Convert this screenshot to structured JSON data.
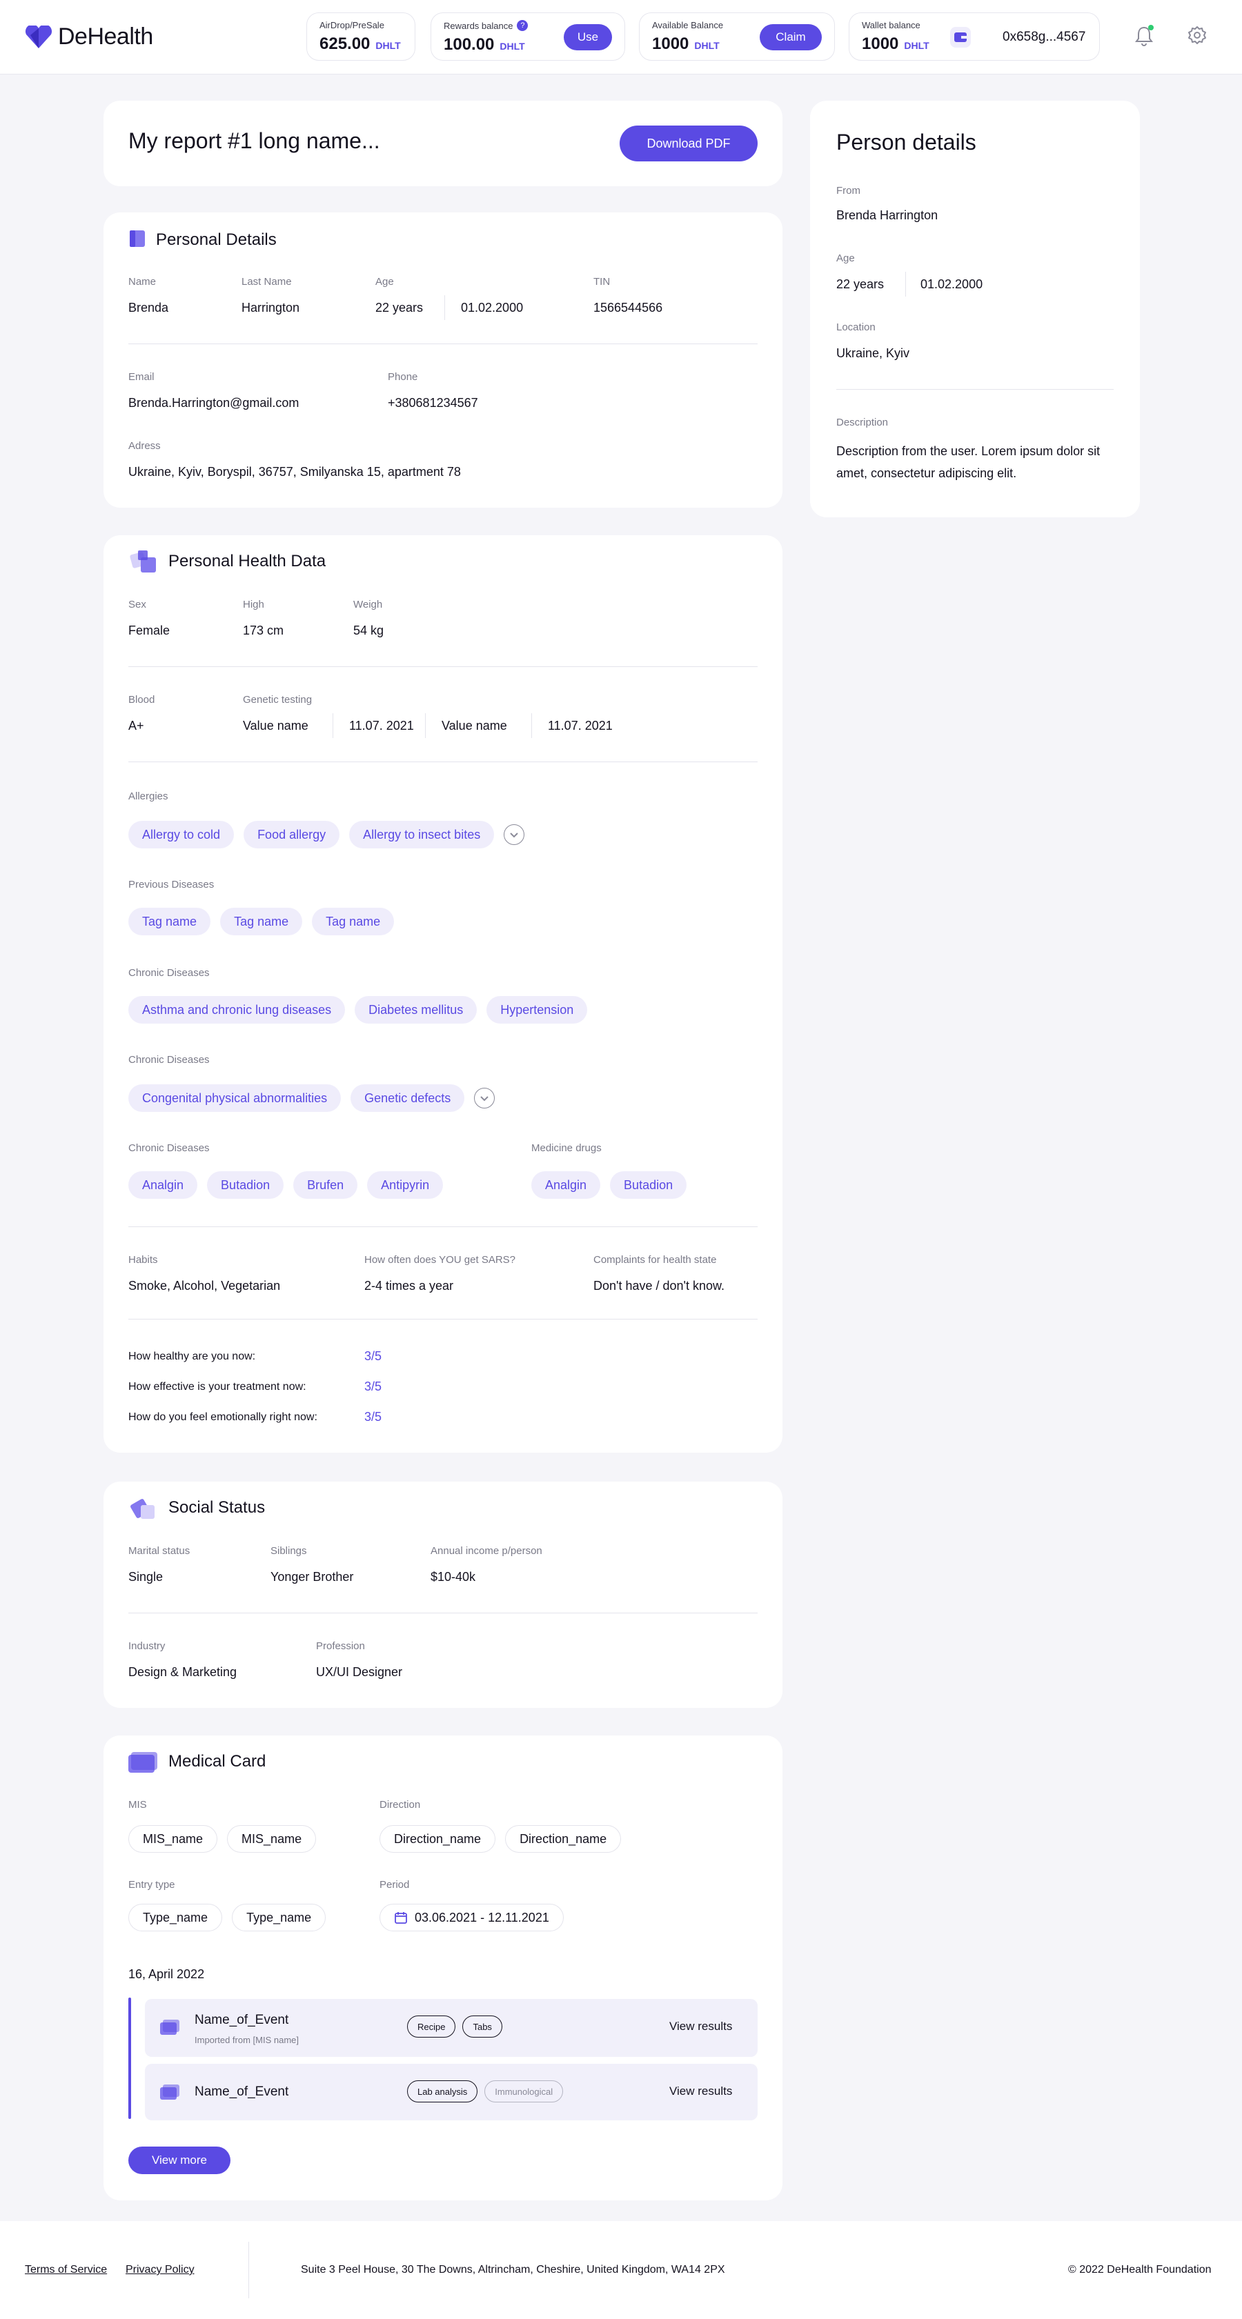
{
  "brand": {
    "name": "DeHealth"
  },
  "header": {
    "airdrop": {
      "label": "AirDrop/PreSale",
      "value": "625.00",
      "unit": "DHLT"
    },
    "rewards": {
      "label": "Rewards balance",
      "help": "?",
      "value": "100.00",
      "unit": "DHLT",
      "button": "Use"
    },
    "available": {
      "label": "Available Balance",
      "value": "1000",
      "unit": "DHLT",
      "button": "Claim"
    },
    "wallet": {
      "label": "Wallet balance",
      "value": "1000",
      "unit": "DHLT",
      "address": "0x658g...4567"
    }
  },
  "report": {
    "title": "My report #1 long name...",
    "download": "Download PDF"
  },
  "personal": {
    "title": "Personal Details",
    "name_label": "Name",
    "name": "Brenda",
    "last_label": "Last Name",
    "last": "Harrington",
    "age_label": "Age",
    "age": "22 years",
    "dob": "01.02.2000",
    "tin_label": "TIN",
    "tin": "1566544566",
    "email_label": "Email",
    "email": "Brenda.Harrington@gmail.com",
    "phone_label": "Phone",
    "phone": "+380681234567",
    "address_label": "Adress",
    "address": "Ukraine, Kyiv, Boryspil, 36757, Smilyanska 15, apartment 78"
  },
  "health": {
    "title": "Personal Health Data",
    "sex_label": "Sex",
    "sex": "Female",
    "high_label": "High",
    "high": "173 cm",
    "weigh_label": "Weigh",
    "weigh": "54 kg",
    "blood_label": "Blood",
    "blood": "A+",
    "genetic_label": "Genetic testing",
    "genetic": [
      {
        "name": "Value name",
        "date": "11.07. 2021"
      },
      {
        "name": "Value name",
        "date": "11.07. 2021"
      }
    ],
    "allergies_label": "Allergies",
    "allergies": [
      "Allergy to cold",
      "Food allergy",
      "Allergy to insect bites"
    ],
    "previous_label": "Previous Diseases",
    "previous": [
      "Tag name",
      "Tag name",
      "Tag name"
    ],
    "chronic1_label": "Chronic Diseases",
    "chronic1": [
      "Asthma and chronic lung diseases",
      "Diabetes mellitus",
      "Hypertension"
    ],
    "chronic2_label": "Chronic Diseases",
    "chronic2": [
      "Congenital physical abnormalities",
      "Genetic defects"
    ],
    "chronic3_label": "Chronic Diseases",
    "chronic3": [
      "Analgin",
      "Butadion",
      "Brufen",
      "Antipyrin"
    ],
    "medicine_label": "Medicine drugs",
    "medicine": [
      "Analgin",
      "Butadion"
    ],
    "habits_label": "Habits",
    "habits": "Smoke, Alcohol, Vegetarian",
    "sars_label": "How often does YOU get SARS?",
    "sars": "2-4 times a year",
    "complaints_label": "Complaints for health state",
    "complaints": "Don't have / don't know.",
    "ratings": [
      {
        "q": "How healthy are you now:",
        "a": "3/5"
      },
      {
        "q": "How effective is your treatment now:",
        "a": "3/5"
      },
      {
        "q": "How do you feel emotionally right now:",
        "a": "3/5"
      }
    ]
  },
  "social": {
    "title": "Social Status",
    "marital_label": "Marital status",
    "marital": "Single",
    "siblings_label": "Siblings",
    "siblings": "Yonger Brother",
    "income_label": "Annual income p/person",
    "income": "$10-40k",
    "industry_label": "Industry",
    "industry": "Design & Marketing",
    "profession_label": "Profession",
    "profession": "UX/UI Designer"
  },
  "medical": {
    "title": "Medical Card",
    "mis_label": "MIS",
    "mis": [
      "MIS_name",
      "MIS_name"
    ],
    "direction_label": "Direction",
    "direction": [
      "Direction_name",
      "Direction_name"
    ],
    "entry_label": "Entry type",
    "entry": [
      "Type_name",
      "Type_name"
    ],
    "period_label": "Period",
    "period": "03.06.2021 - 12.11.2021",
    "date": "16, April 2022",
    "events": [
      {
        "name": "Name_of_Event",
        "sub": "Imported from [MIS name]",
        "tags": [
          "Recipe",
          "Tabs"
        ],
        "action": "View results"
      },
      {
        "name": "Name_of_Event",
        "sub": "",
        "tags": [
          "Lab analysis",
          "Immunological"
        ],
        "action": "View results"
      }
    ],
    "more": "View more"
  },
  "person": {
    "title": "Person details",
    "from_label": "From",
    "from": "Brenda Harrington",
    "age_label": "Age",
    "age": "22 years",
    "dob": "01.02.2000",
    "location_label": "Location",
    "location": "Ukraine, Kyiv",
    "desc_label": "Description",
    "desc": "Description from the user. Lorem ipsum dolor sit amet, consectetur adipiscing elit."
  },
  "footer": {
    "terms": "Terms of Service",
    "privacy": "Privacy Policy",
    "address": "Suite 3 Peel House, 30 The Downs, Altrincham, Cheshire, United Kingdom, WA14 2PX",
    "copyright": "© 2022 DeHealth Foundation"
  },
  "colors": {
    "accent": "#5a4ae3",
    "background": "#f5f5f9",
    "tag_bg": "#efedfb",
    "online": "#2ecc71"
  }
}
